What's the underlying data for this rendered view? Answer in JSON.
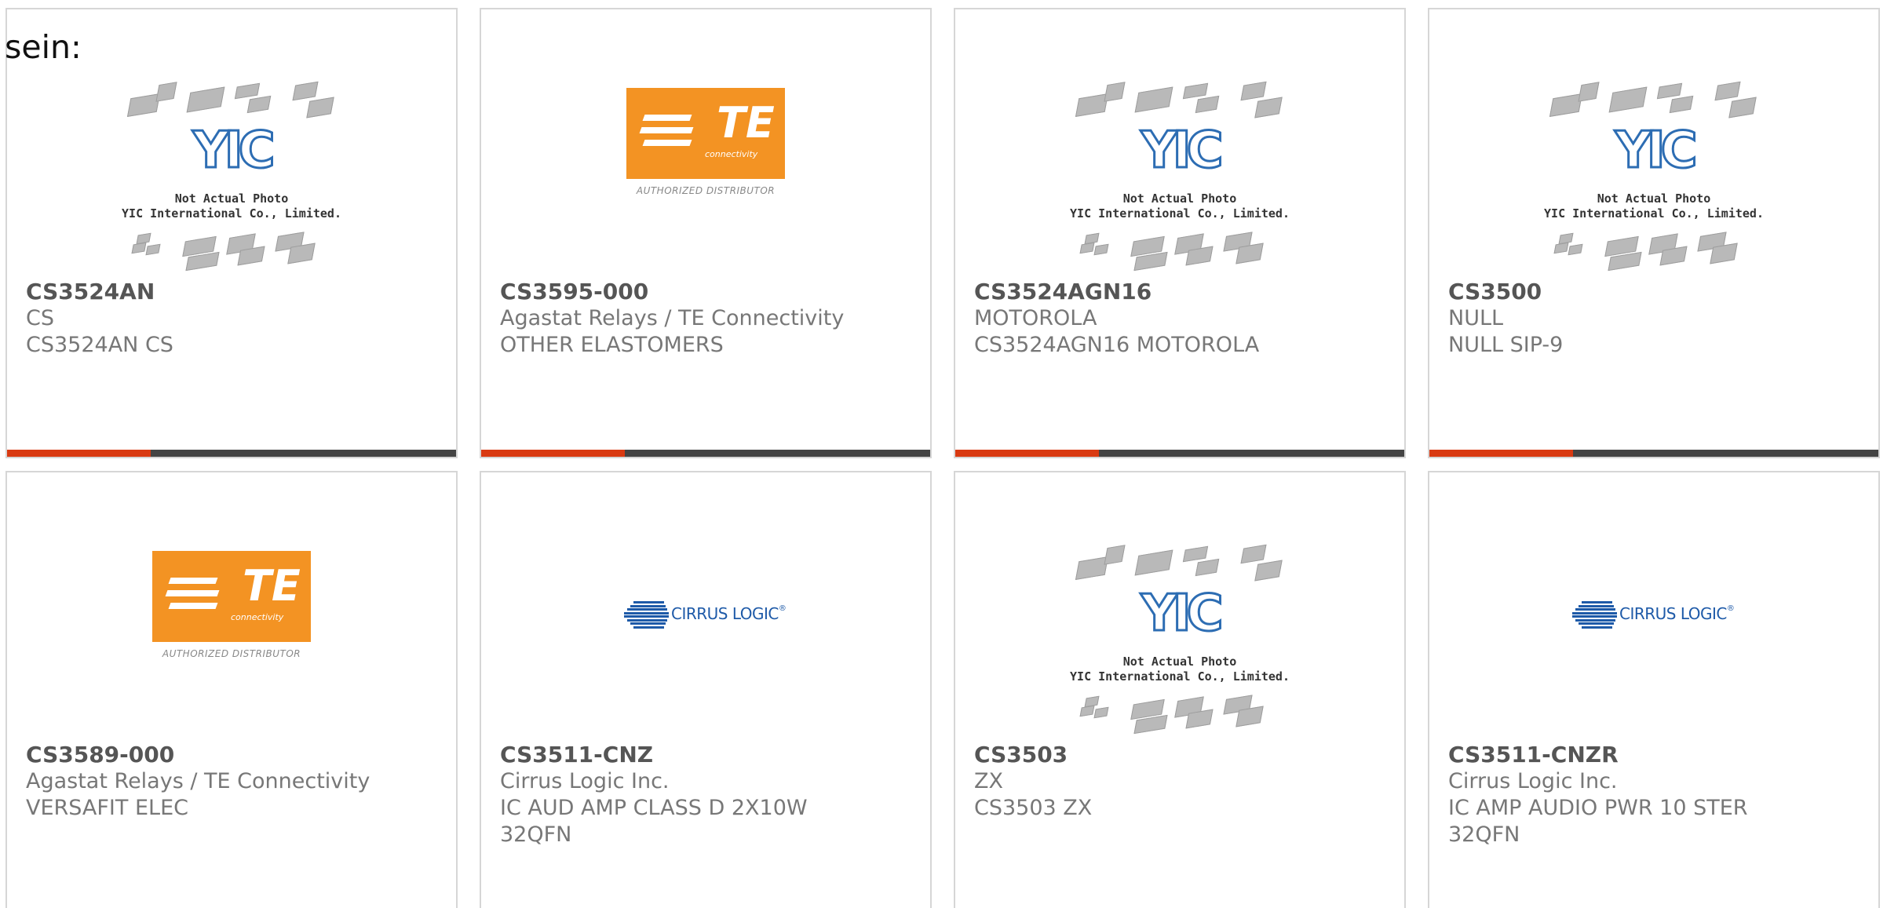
{
  "header": {
    "partial_word": "sein:"
  },
  "colors": {
    "accent_bar": "#d93a12",
    "bar_dark": "#444444",
    "te_orange": "#f39323",
    "yic_blue": "#2d6db3",
    "cirrus_blue": "#1e5aa8"
  },
  "logos": {
    "yic": {
      "mark": "YIC",
      "line1": "Not Actual Photo",
      "line2": "YIC International Co., Limited."
    },
    "te": {
      "mark": "TE",
      "sub": "connectivity",
      "caption": "AUTHORIZED DISTRIBUTOR"
    },
    "cirrus": {
      "word": "CIRRUS LOGIC",
      "reg": "®"
    }
  },
  "products": [
    {
      "part": "CS3524AN",
      "manufacturer": "CS",
      "desc": "CS3524AN CS",
      "desc2": "",
      "image": "yic"
    },
    {
      "part": "CS3595-000",
      "manufacturer": "Agastat Relays / TE Connectivity",
      "desc": "OTHER ELASTOMERS",
      "desc2": "",
      "image": "te"
    },
    {
      "part": "CS3524AGN16",
      "manufacturer": "MOTOROLA",
      "desc": "CS3524AGN16 MOTOROLA",
      "desc2": "",
      "image": "yic"
    },
    {
      "part": "CS3500",
      "manufacturer": "NULL",
      "desc": "NULL SIP-9",
      "desc2": "",
      "image": "yic"
    },
    {
      "part": "CS3589-000",
      "manufacturer": "Agastat Relays / TE Connectivity",
      "desc": "VERSAFIT ELEC",
      "desc2": "",
      "image": "te"
    },
    {
      "part": "CS3511-CNZ",
      "manufacturer": "Cirrus Logic Inc.",
      "desc": "IC AUD AMP CLASS D 2X10W",
      "desc2": "32QFN",
      "image": "cirrus"
    },
    {
      "part": "CS3503",
      "manufacturer": "ZX",
      "desc": "CS3503 ZX",
      "desc2": "",
      "image": "yic"
    },
    {
      "part": "CS3511-CNZR",
      "manufacturer": "Cirrus Logic Inc.",
      "desc": "IC AMP AUDIO PWR 10 STER",
      "desc2": "32QFN",
      "image": "cirrus"
    }
  ]
}
